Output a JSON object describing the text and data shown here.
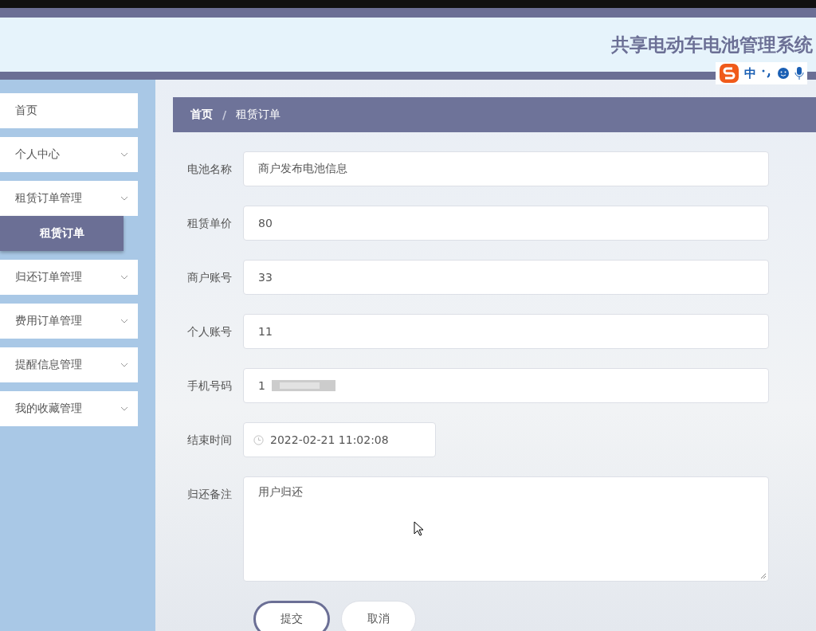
{
  "header": {
    "title": "共享电动车电池管理系统"
  },
  "ime_toolbar": {
    "mode": "中"
  },
  "sidebar": {
    "items": [
      {
        "label": "首页",
        "expandable": false
      },
      {
        "label": "个人中心",
        "expandable": true
      },
      {
        "label": "租赁订单管理",
        "expandable": true,
        "children": [
          {
            "label": "租赁订单",
            "selected": true
          }
        ]
      },
      {
        "label": "归还订单管理",
        "expandable": true
      },
      {
        "label": "费用订单管理",
        "expandable": true
      },
      {
        "label": "提醒信息管理",
        "expandable": true
      },
      {
        "label": "我的收藏管理",
        "expandable": true
      }
    ]
  },
  "breadcrumb": [
    {
      "label": "首页",
      "current": false
    },
    {
      "label": "租赁订单",
      "current": true
    }
  ],
  "breadcrumb_separator": "/",
  "form": {
    "fields": [
      {
        "kind": "text",
        "label": "电池名称",
        "value": "商户发布电池信息"
      },
      {
        "kind": "text",
        "label": "租赁单价",
        "value": "80"
      },
      {
        "kind": "text",
        "label": "商户账号",
        "value": "33"
      },
      {
        "kind": "text",
        "label": "个人账号",
        "value": "11"
      },
      {
        "kind": "redacted",
        "label": "手机号码",
        "value": "1"
      },
      {
        "kind": "datetime",
        "label": "结束时间",
        "value": "2022-02-21 11:02:08"
      },
      {
        "kind": "textarea",
        "label": "归还备注",
        "value": "用户归还"
      }
    ],
    "buttons": [
      {
        "label": "提交",
        "primary": true
      },
      {
        "label": "取消",
        "primary": false
      }
    ]
  }
}
